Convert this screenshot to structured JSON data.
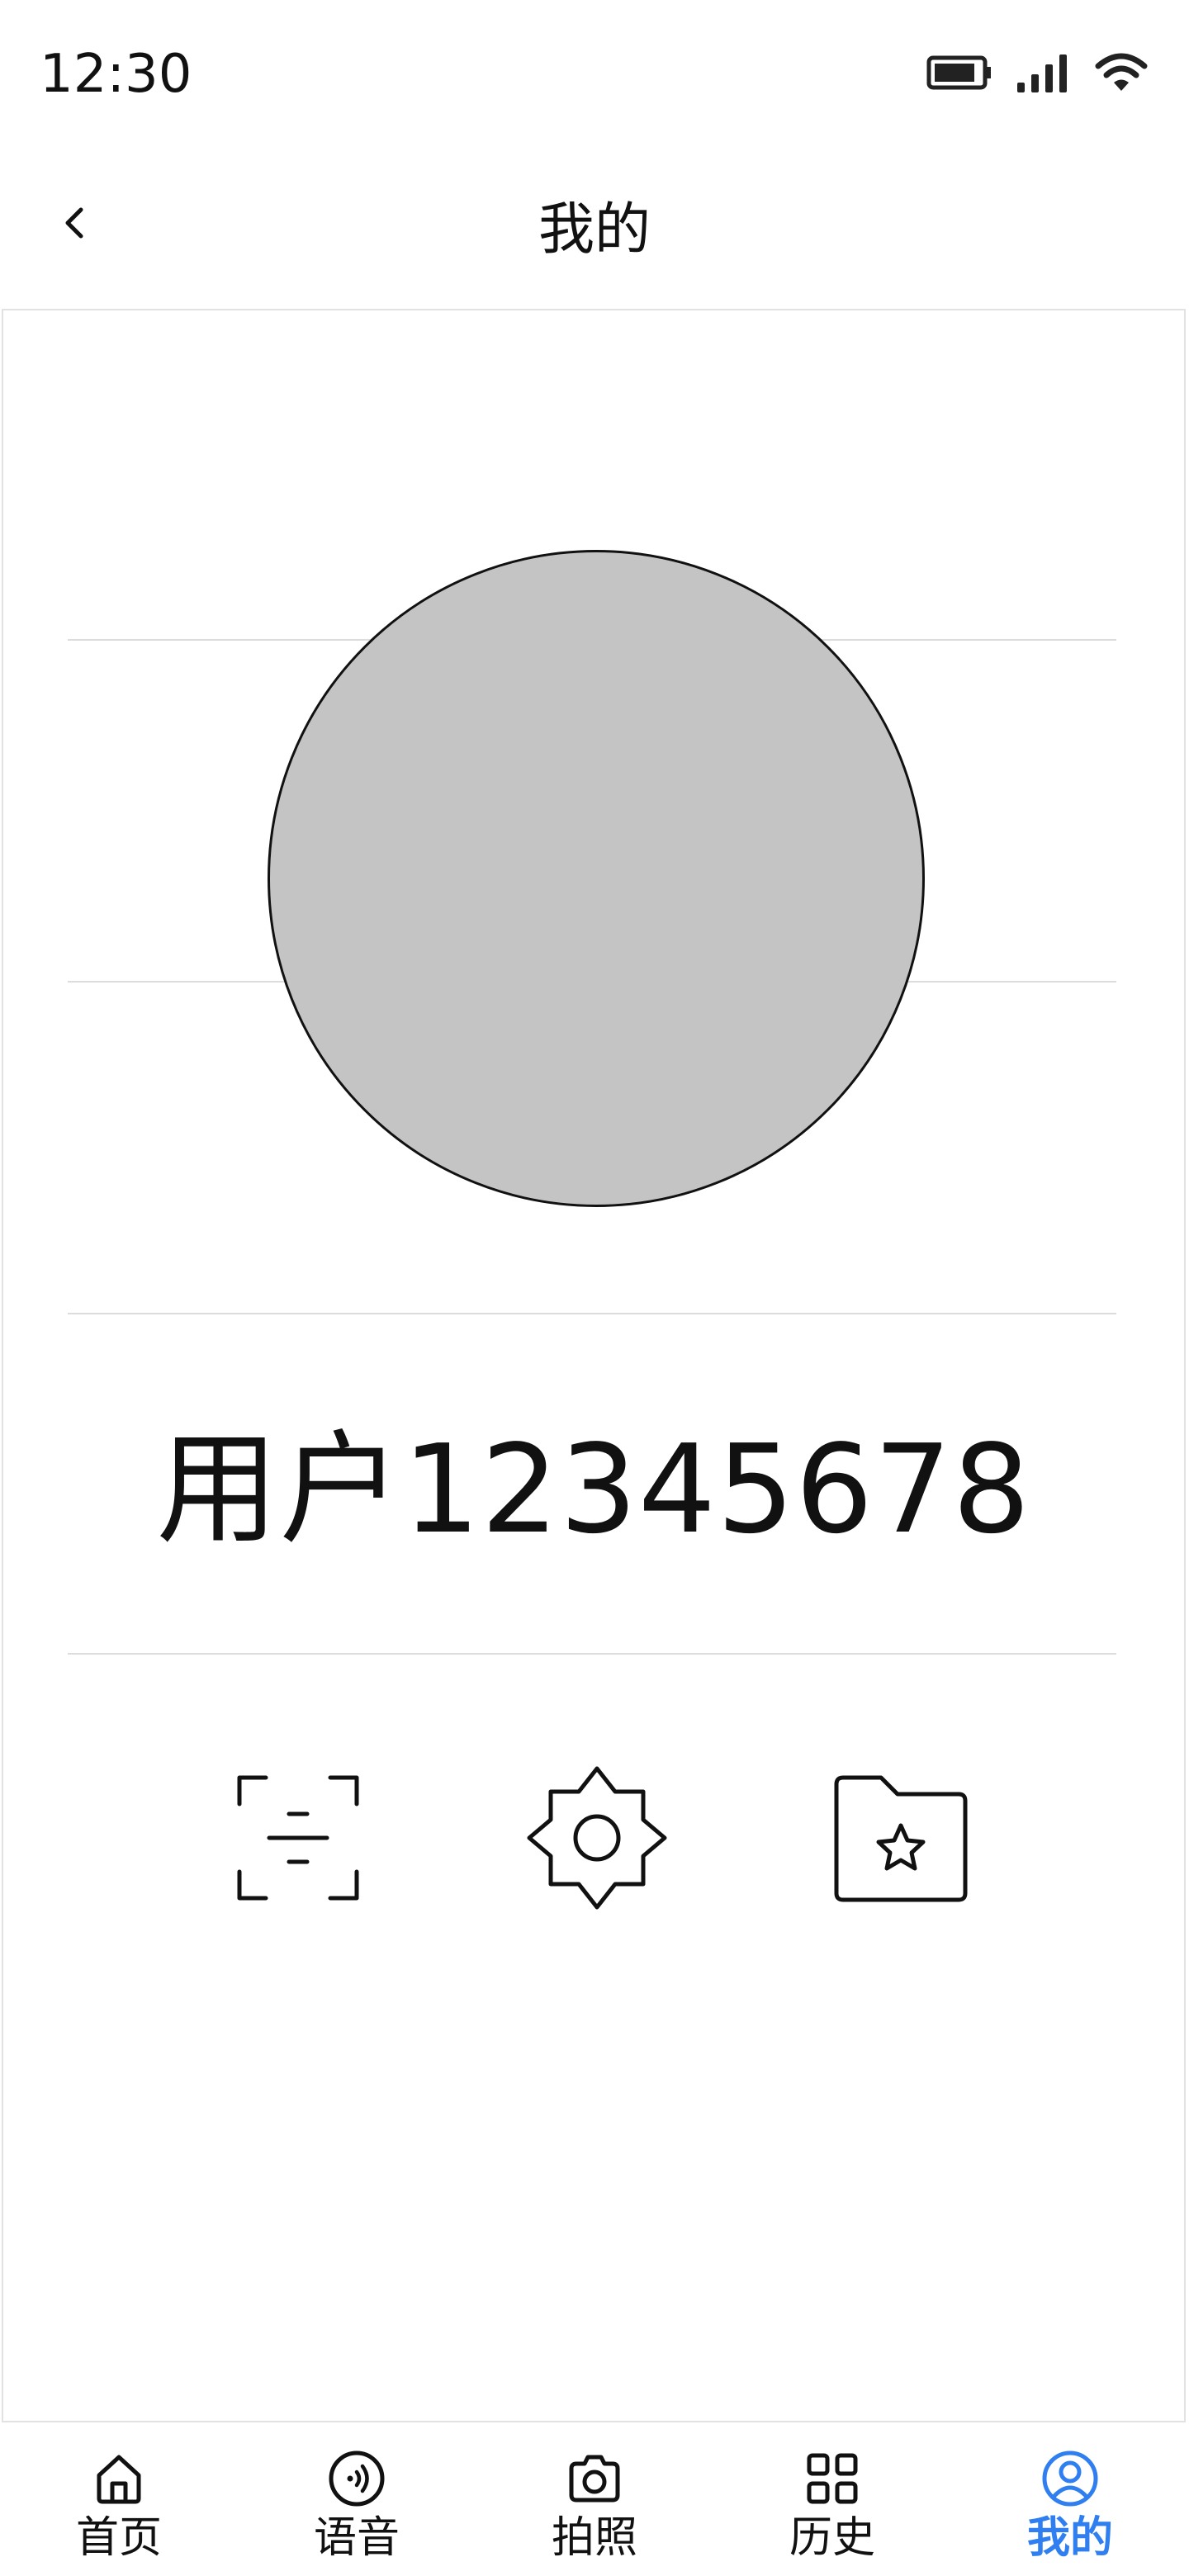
{
  "status_bar": {
    "time": "12:30",
    "icons": [
      "battery-icon",
      "signal-icon",
      "wifi-icon"
    ]
  },
  "header": {
    "title": "我的",
    "back_icon": "chevron-left-icon"
  },
  "profile": {
    "username": "用户12345678",
    "avatar_color": "#c4c4c4"
  },
  "actions": [
    {
      "name": "scan",
      "icon": "scan-icon"
    },
    {
      "name": "settings",
      "icon": "settings-gear-icon"
    },
    {
      "name": "favorites",
      "icon": "folder-star-icon"
    }
  ],
  "tabs": [
    {
      "label": "首页",
      "icon": "home-icon"
    },
    {
      "label": "语音",
      "icon": "voice-icon"
    },
    {
      "label": "拍照",
      "icon": "camera-icon"
    },
    {
      "label": "历史",
      "icon": "grid-icon"
    },
    {
      "label": "我的",
      "icon": "user-circle-icon",
      "active": true
    }
  ],
  "colors": {
    "accent": "#2f7ff0",
    "text": "#111111",
    "divider": "#dcdcdc"
  }
}
